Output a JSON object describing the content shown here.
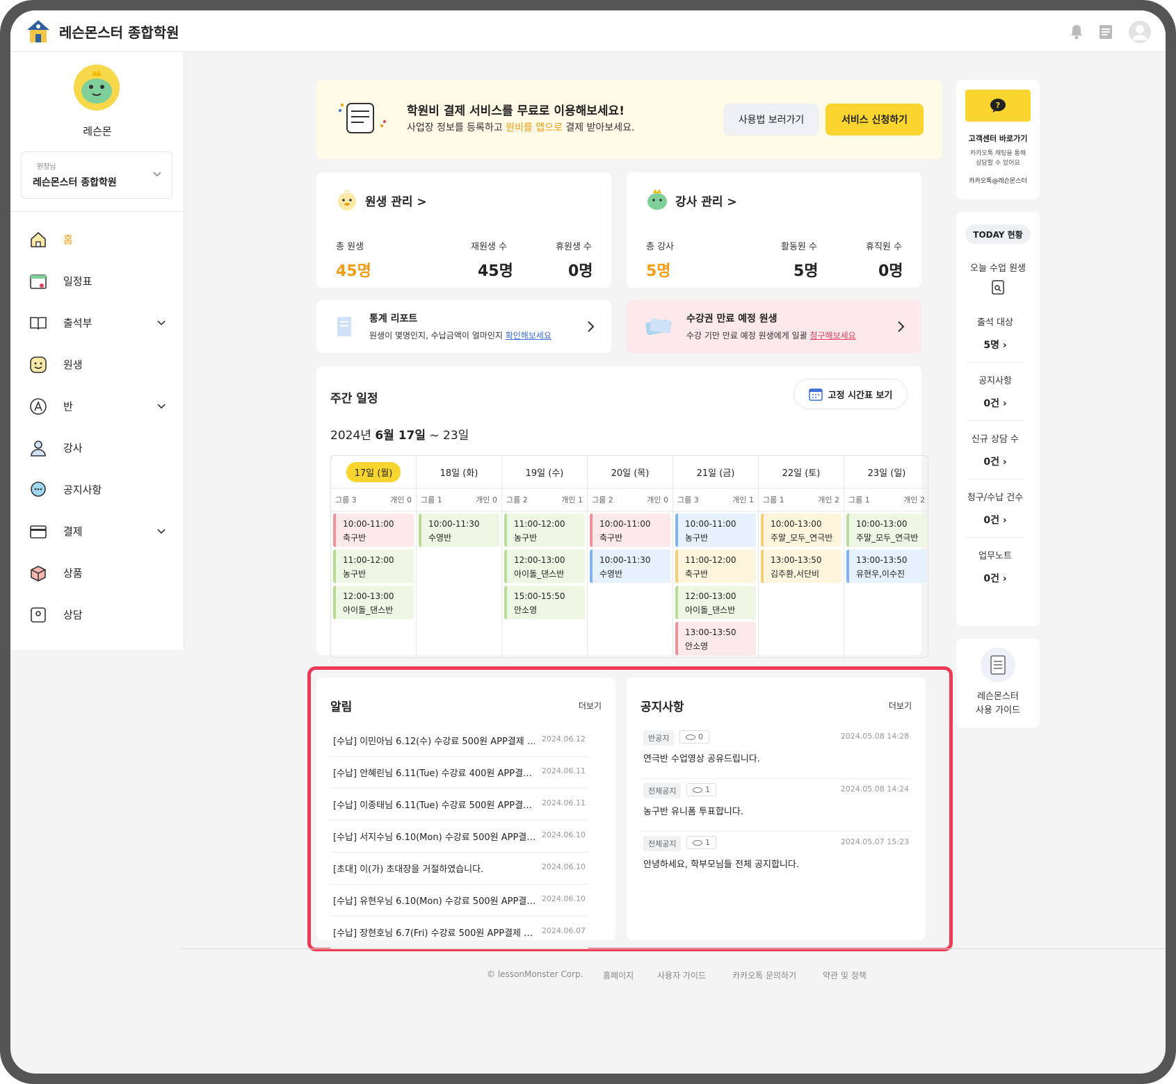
{
  "app": {
    "title": "레슨몬스터 종합학원"
  },
  "header_icons": [
    "bell-icon",
    "document-icon",
    "user-avatar-icon"
  ],
  "sidebar": {
    "user_name": "레슨몬",
    "role": "원장님",
    "academy": "레슨몬스터 종합학원",
    "items": [
      {
        "label": "홈",
        "icon": "home-icon",
        "active": true
      },
      {
        "label": "일정표",
        "icon": "calendar-icon"
      },
      {
        "label": "출석부",
        "icon": "book-icon",
        "expandable": true
      },
      {
        "label": "원생",
        "icon": "smile-icon"
      },
      {
        "label": "반",
        "icon": "class-icon",
        "expandable": true
      },
      {
        "label": "강사",
        "icon": "person-icon"
      },
      {
        "label": "공지사항",
        "icon": "chat-icon"
      },
      {
        "label": "결제",
        "icon": "card-icon",
        "expandable": true
      },
      {
        "label": "상품",
        "icon": "box-icon"
      },
      {
        "label": "상담",
        "icon": "consult-icon"
      }
    ]
  },
  "banner": {
    "title": "학원비 결제 서비스를 무료로 이용해보세요!",
    "desc_pre": "사업장 정보를 등록하고 ",
    "desc_hl": "원비를 앱으로",
    "desc_post": " 결제 받아보세요.",
    "guide_button": "사용법 보러가기",
    "apply_button": "서비스 신청하기"
  },
  "students": {
    "title": "원생 관리 >",
    "total_label": "총 원생",
    "total_value": "45명",
    "enrolled_label": "재원생 수",
    "enrolled_value": "45명",
    "paused_label": "휴원생 수",
    "paused_value": "0명"
  },
  "teachers": {
    "title": "강사 관리 >",
    "total_label": "총 강사",
    "total_value": "5명",
    "active_label": "활동원 수",
    "active_value": "5명",
    "leave_label": "휴직원 수",
    "leave_value": "0명"
  },
  "report": {
    "title": "통계 리포트",
    "desc": "원생이 몇명인지, 수납금액이 얼마인지 ",
    "link": "확인해보세요"
  },
  "expiry": {
    "title": "수강권 만료 예정 원생",
    "desc": "수강 기만 만료 예정 원생에게 일괄 ",
    "link": "청구해보세요"
  },
  "weekly": {
    "title": "주간 일정",
    "fixed_button": "고정 시간표 보기",
    "range_pre": "2024년 ",
    "range_bold": "6월 17일",
    "range_post": " ~ 23일",
    "days": [
      {
        "label": "17일 (월)",
        "today": true,
        "group": "그룹 3",
        "personal": "개인 0",
        "events": [
          {
            "time": "10:00-11:00",
            "name": "축구반",
            "color": "red"
          },
          {
            "time": "11:00-12:00",
            "name": "농구반",
            "color": "green"
          },
          {
            "time": "12:00-13:00",
            "name": "아이돌_댄스반",
            "color": "green"
          }
        ]
      },
      {
        "label": "18일 (화)",
        "group": "그룹 1",
        "personal": "개인 0",
        "events": [
          {
            "time": "10:00-11:30",
            "name": "수영반",
            "color": "green"
          }
        ]
      },
      {
        "label": "19일 (수)",
        "group": "그룹 2",
        "personal": "개인 1",
        "events": [
          {
            "time": "11:00-12:00",
            "name": "농구반",
            "color": "green"
          },
          {
            "time": "12:00-13:00",
            "name": "아이돌_댄스반",
            "color": "green"
          },
          {
            "time": "15:00-15:50",
            "name": "안소영",
            "color": "green"
          }
        ]
      },
      {
        "label": "20일 (목)",
        "group": "그룹 2",
        "personal": "개인 0",
        "events": [
          {
            "time": "10:00-11:00",
            "name": "축구반",
            "color": "red"
          },
          {
            "time": "10:00-11:30",
            "name": "수영반",
            "color": "blue"
          }
        ]
      },
      {
        "label": "21일 (금)",
        "group": "그룹 3",
        "personal": "개인 1",
        "events": [
          {
            "time": "10:00-11:00",
            "name": "농구반",
            "color": "blue"
          },
          {
            "time": "11:00-12:00",
            "name": "축구반",
            "color": "yel"
          },
          {
            "time": "12:00-13:00",
            "name": "아이돌_댄스반",
            "color": "green"
          },
          {
            "time": "13:00-13:50",
            "name": "안소영",
            "color": "red"
          }
        ]
      },
      {
        "label": "22일 (토)",
        "group": "그룹 1",
        "personal": "개인 2",
        "events": [
          {
            "time": "10:00-13:00",
            "name": "주말_모두_연극반",
            "color": "yel"
          },
          {
            "time": "13:00-13:50",
            "name": "김주환,서단비",
            "color": "yel"
          }
        ]
      },
      {
        "label": "23일 (일)",
        "group": "그룹 1",
        "personal": "개인 2",
        "events": [
          {
            "time": "10:00-13:00",
            "name": "주말_모두_연극반",
            "color": "green"
          },
          {
            "time": "13:00-13:50",
            "name": "유현우,이수진",
            "color": "blue"
          }
        ]
      }
    ]
  },
  "alerts": {
    "title": "알림",
    "more": "더보기",
    "items": [
      {
        "text": "[수납] 이민아님 6.12(수) 수강료 500원 APP결제 …",
        "date": "2024.06.12"
      },
      {
        "text": "[수납] 안혜린님 6.11(Tue) 수강료 400원 APP결…",
        "date": "2024.06.11"
      },
      {
        "text": "[수납] 이종태님 6.11(Tue) 수강료 500원 APP결…",
        "date": "2024.06.11"
      },
      {
        "text": "[수납] 서지수님 6.10(Mon) 수강료 500원 APP결…",
        "date": "2024.06.10"
      },
      {
        "text": "[초대] 이(가) 초대장을 거절하였습니다.",
        "date": "2024.06.10"
      },
      {
        "text": "[수납] 유현우님 6.10(Mon) 수강료 500원 APP결…",
        "date": "2024.06.10"
      },
      {
        "text": "[수납] 장현호님 6.7(Fri) 수강료 500원 APP결제 …",
        "date": "2024.06.07"
      }
    ]
  },
  "notices": {
    "title": "공지사항",
    "more": "더보기",
    "items": [
      {
        "tag": "반공지",
        "views": "0",
        "date": "2024.05.08 14:28",
        "text": "연극반 수업영상 공유드립니다."
      },
      {
        "tag": "전체공지",
        "views": "1",
        "date": "2024.05.08 14:24",
        "text": "농구반 유니폼 투표합니다."
      },
      {
        "tag": "전체공지",
        "views": "1",
        "date": "2024.05.07 15:23",
        "text": "안녕하세요, 학부모님들 전체 공지합니다."
      }
    ]
  },
  "support": {
    "title": "고객센터 바로가기",
    "desc1": "카카오톡 채팅을 통해",
    "desc2": "상담할 수 있어요",
    "kakao": "카카오톡@레슨몬스터"
  },
  "today": {
    "badge": "TODAY 현황",
    "class_label": "오늘 수업 원생",
    "items": [
      {
        "label": "출석 대상",
        "value": "5명 ›"
      },
      {
        "label": "공지사항",
        "value": "0건 ›"
      },
      {
        "label": "신규 상담 수",
        "value": "0건 ›"
      },
      {
        "label": "청구/수납 건수",
        "value": "0건 ›"
      },
      {
        "label": "업무노트",
        "value": "0건 ›"
      }
    ]
  },
  "guide": {
    "line1": "레슨몬스터",
    "line2": "사용 가이드"
  },
  "footer": {
    "copyright": "© lessonMonster Corp.",
    "links": [
      "홈페이지",
      "사용자 가이드",
      "카카오톡 문의하기",
      "약관 및 정책"
    ]
  },
  "colors": {
    "accent": "#f39c12",
    "yellow": "#fbd52f",
    "highlight_border": "#ee3a55",
    "link_blue": "#3d6fd6",
    "link_red": "#e0425a"
  }
}
